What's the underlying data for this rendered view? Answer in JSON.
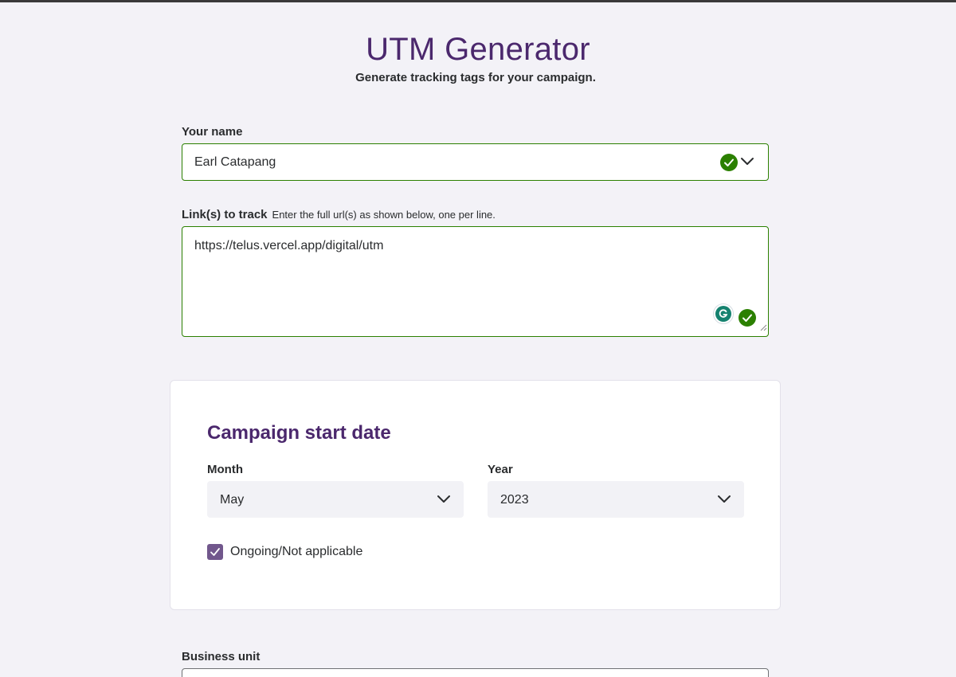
{
  "header": {
    "title": "UTM Generator",
    "subtitle": "Generate tracking tags for your campaign."
  },
  "your_name": {
    "label": "Your name",
    "value": "Earl Catapang"
  },
  "links": {
    "label": "Link(s) to track",
    "hint": "Enter the full url(s) as shown below, one per line.",
    "value": "https://telus.vercel.app/digital/utm"
  },
  "campaign_start": {
    "title": "Campaign start date",
    "month_label": "Month",
    "month_value": "May",
    "year_label": "Year",
    "year_value": "2023",
    "ongoing_label": "Ongoing/Not applicable",
    "ongoing_checked": true
  },
  "business_unit": {
    "label": "Business unit"
  },
  "colors": {
    "brand_purple": "#4b286d",
    "valid_green": "#2b8000",
    "checkbox_purple": "#71578c",
    "background": "#f3f2f7"
  },
  "icons": [
    "check-circle-icon",
    "chevron-down-icon",
    "grammarly-icon",
    "resize-grip-icon",
    "checkmark-icon"
  ]
}
